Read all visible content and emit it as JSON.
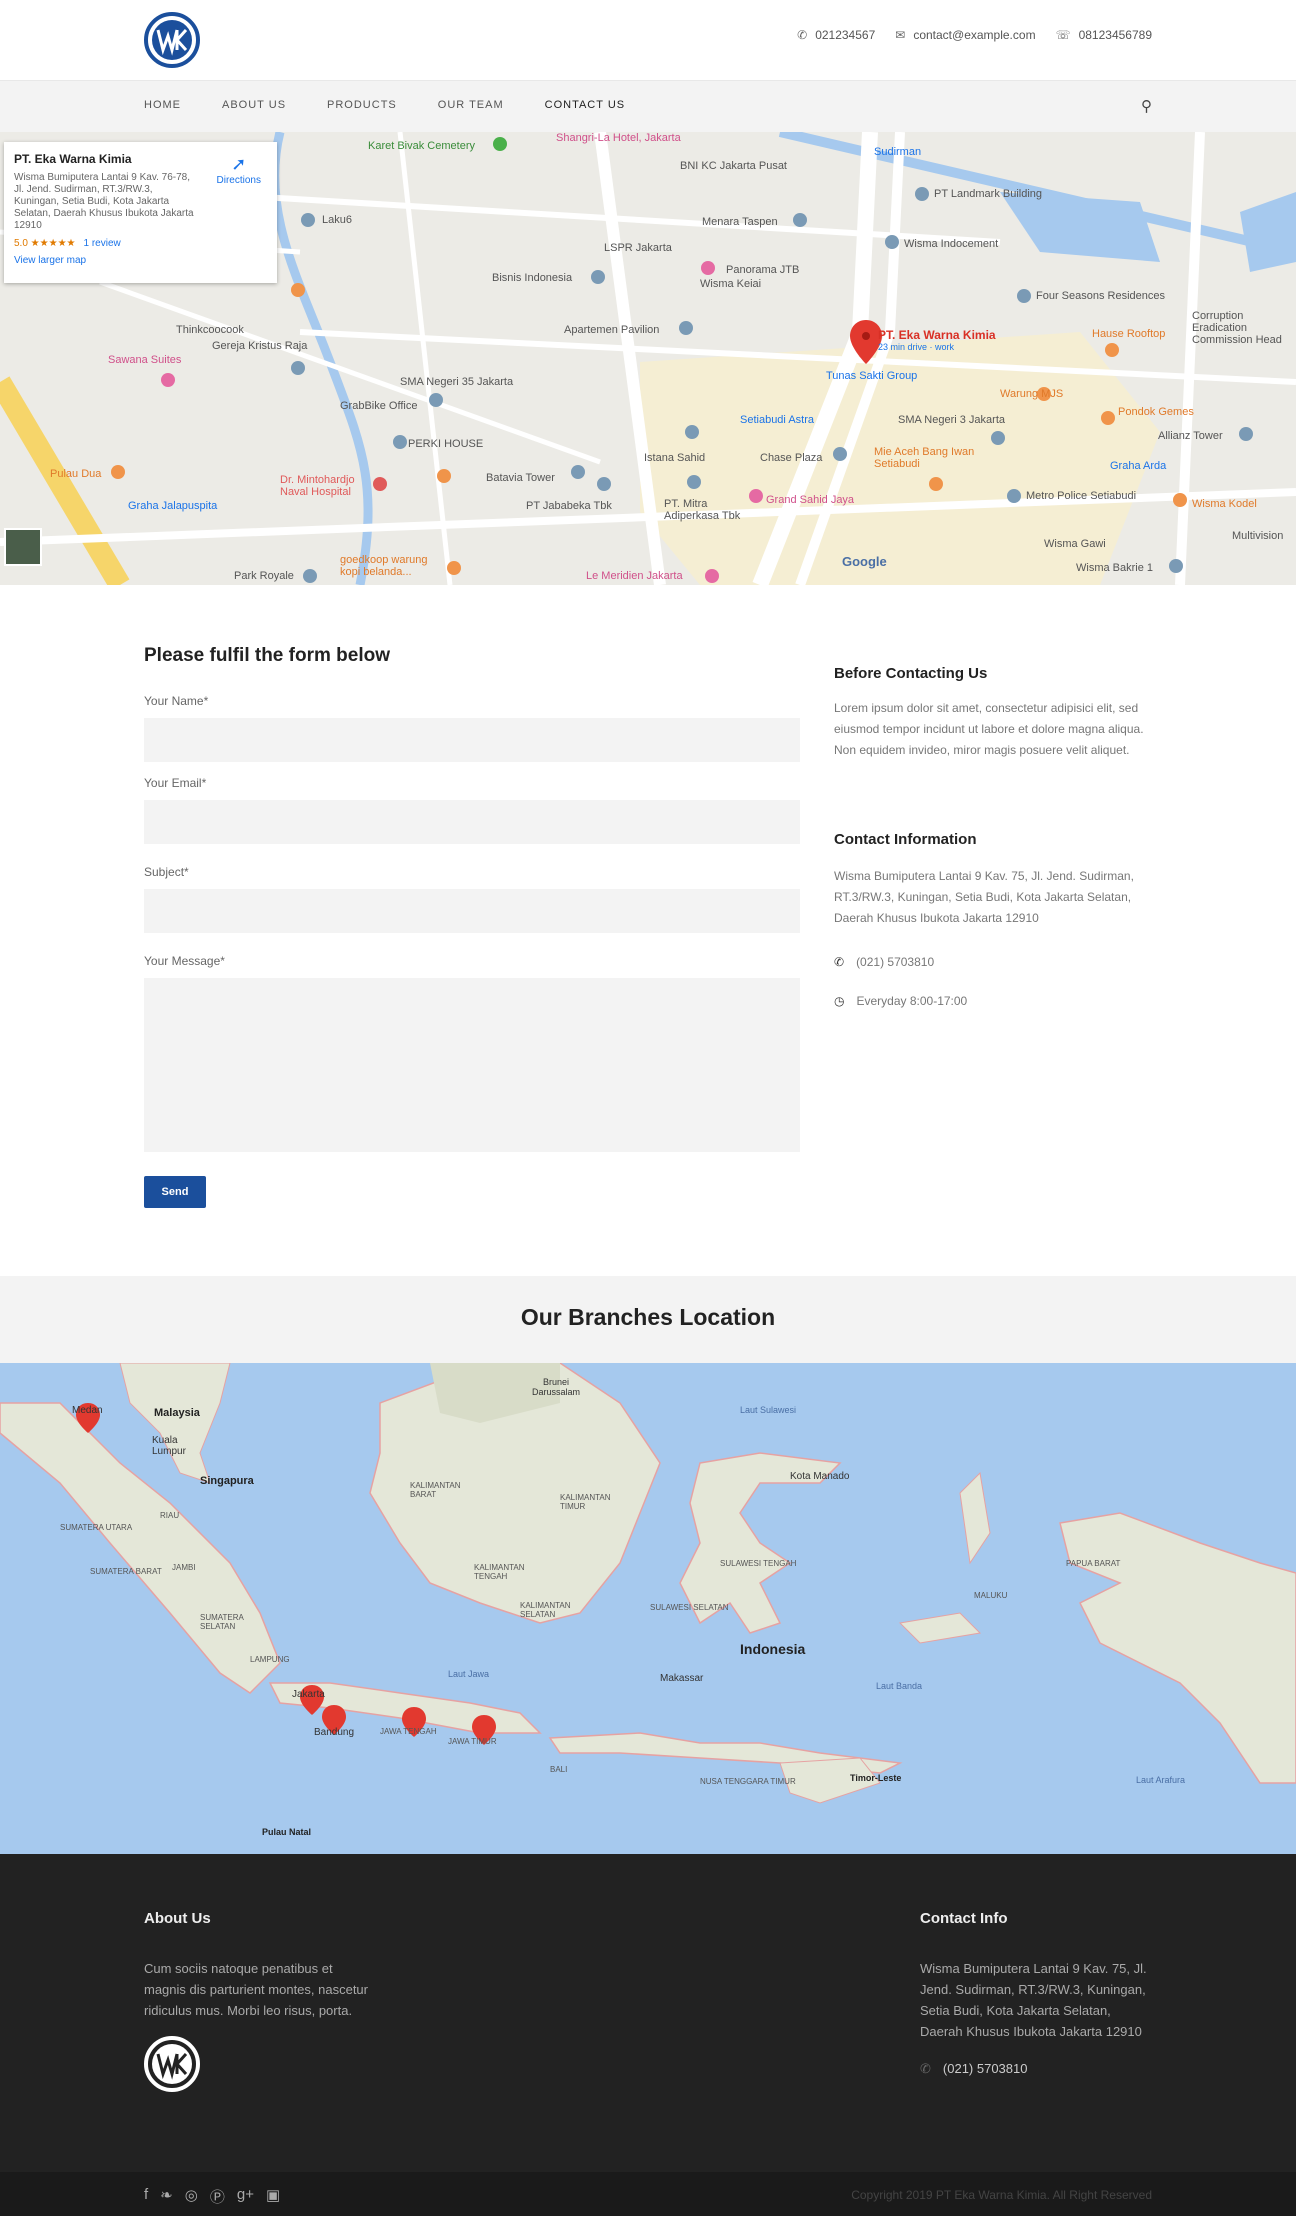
{
  "header": {
    "logo_alt": "WK",
    "phone": "021234567",
    "email": "contact@example.com",
    "whatsapp": "08123456789"
  },
  "nav": {
    "items": [
      "HOME",
      "ABOUT US",
      "PRODUCTS",
      "OUR TEAM",
      "CONTACT US"
    ],
    "active": "CONTACT US"
  },
  "map_top": {
    "card_title": "PT. Eka Warna Kimia",
    "card_address": "Wisma Bumiputera Lantai 9 Kav. 76-78, Jl. Jend. Sudirman, RT.3/RW.3, Kuningan, Setia Budi, Kota Jakarta Selatan, Daerah Khusus Ibukota Jakarta 12910",
    "rating": "5.0 ★★★★★",
    "reviews": "1 review",
    "larger": "View larger map",
    "directions": "Directions",
    "pin_label": "PT. Eka Warna Kimia",
    "pin_sub": "23 min drive · work",
    "places": [
      "Karet Bivak Cemetery",
      "Shangri-La Hotel, Jakarta",
      "BNI KC Jakarta Pusat",
      "PT Landmark Building",
      "Sudirman",
      "Menara Taspen",
      "Wisma Indocement",
      "Laku6",
      "LSPR Jakarta",
      "Bisnis Indonesia",
      "Panorama JTB",
      "Wisma Keiai",
      "Four Seasons Residences",
      "Hause Rooftop",
      "Corruption Eradication Commission Head",
      "Thinkcoocook",
      "Gereja Kristus Raja",
      "Apartemen Pavilion",
      "Sawana Suites",
      "SMA Negeri 35 Jakarta",
      "Tunas Sakti Group",
      "Warung MJS",
      "GrabBike Office",
      "Setiabudi Astra",
      "SMA Negeri 3 Jakarta",
      "Pondok Gemes",
      "Allianz Tower",
      "PERKI HOUSE",
      "Istana Sahid",
      "Chase Plaza",
      "Mie Aceh Bang Iwan Setiabudi",
      "Graha Arda",
      "Pulau Dua",
      "Batavia Tower",
      "Dr. Mintohardjo Naval Hospital",
      "PT Jababeka Tbk",
      "PT. Mitra Adiperkasa Tbk",
      "Grand Sahid Jaya",
      "Metro Police Setiabudi",
      "Wisma Kodel",
      "Graha Jalapuspita",
      "Wisma Gawi",
      "Multivision",
      "Park Royale",
      "goedkoop warung kopi belanda...",
      "Le Meridien Jakarta",
      "Wisma Bakrie 1",
      "Google"
    ]
  },
  "form": {
    "title": "Please fulfil the form below",
    "name_label": "Your Name*",
    "email_label": "Your Email*",
    "subject_label": "Subject*",
    "message_label": "Your Message*",
    "send": "Send"
  },
  "aside": {
    "before_title": "Before Contacting Us",
    "before_text": "Lorem ipsum dolor sit amet, consectetur adipisici elit, sed eiusmod tempor incidunt ut labore et dolore magna aliqua. Non equidem invideo, miror magis posuere velit aliquet.",
    "info_title": "Contact Information",
    "info_address": "Wisma Bumiputera Lantai 9 Kav. 75, Jl. Jend. Sudirman, RT.3/RW.3, Kuningan, Setia Budi, Kota Jakarta Selatan, Daerah Khusus Ibukota Jakarta 12910",
    "phone": "(021) 5703810",
    "hours": "Everyday 8:00-17:00"
  },
  "branches": {
    "title": "Our Branches Location",
    "places": [
      "Malaysia",
      "Kuala Lumpur",
      "Singapura",
      "Medan",
      "Brunei Darussalam",
      "Laut Sulawesi",
      "Kota Manado",
      "Indonesia",
      "Makassar",
      "Jakarta",
      "Bandung",
      "Jawa Tengah",
      "Jawa Timur",
      "Bali",
      "Laut Jawa",
      "Laut Banda",
      "Laut Arafura",
      "Timor-Leste",
      "Pulau Natal",
      "Kalimantan Barat",
      "Kalimantan Tengah",
      "Kalimantan Selatan",
      "Kalimantan Timur",
      "Sumatera Utara",
      "Sumatera Barat",
      "Sumatera Selatan",
      "Jambi",
      "Riau",
      "Lampung",
      "Papua Barat",
      "Maluku",
      "Sulawesi Tengah",
      "Sulawesi Selatan",
      "Nusa Tenggara Timur"
    ]
  },
  "footer": {
    "about_title": "About Us",
    "about_text": "Cum sociis natoque penatibus et magnis dis parturient montes, nascetur ridiculus mus. Morbi leo risus, porta.",
    "contact_title": "Contact Info",
    "contact_address": "Wisma Bumiputera Lantai 9 Kav. 75, Jl. Jend. Sudirman, RT.3/RW.3, Kuningan, Setia Budi, Kota Jakarta Selatan, Daerah Khusus Ibukota Jakarta 12910",
    "contact_phone": "(021) 5703810",
    "copyright": "Copyright 2019 PT Eka Warna Kimia. All Right Reserved",
    "social_icons": [
      "facebook-icon",
      "twitter-icon",
      "dribbble-icon",
      "pinterest-icon",
      "googleplus-icon",
      "instagram-icon"
    ]
  },
  "colors": {
    "brand": "#1b4f9c",
    "footer": "#222222"
  }
}
